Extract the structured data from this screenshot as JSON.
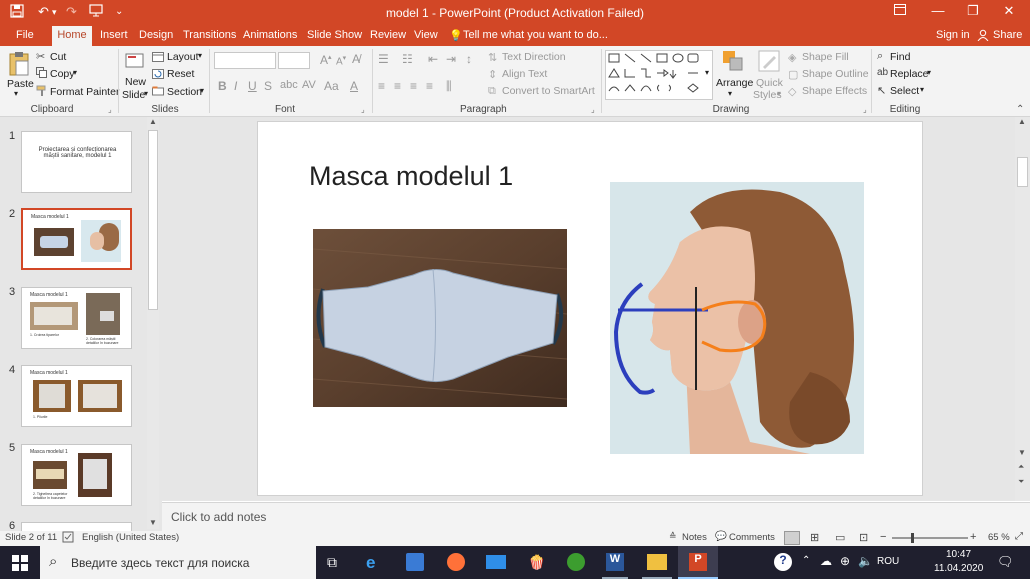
{
  "titlebar": {
    "title": "model 1 - PowerPoint (Product Activation Failed)",
    "save_icon": "save-icon",
    "undo_icon": "undo-icon",
    "redo_icon": "redo-icon",
    "present_icon": "present-from-beginning-icon"
  },
  "tabs": [
    "File",
    "Home",
    "Insert",
    "Design",
    "Transitions",
    "Animations",
    "Slide Show",
    "Review",
    "View"
  ],
  "tell_me": "Tell me what you want to do...",
  "sign_in": "Sign in",
  "share": "Share",
  "ribbon": {
    "clipboard": {
      "paste": "Paste",
      "cut": "Cut",
      "copy": "Copy",
      "format_painter": "Format Painter",
      "label": "Clipboard"
    },
    "slides": {
      "new_slide_1": "New",
      "new_slide_2": "Slide",
      "layout": "Layout",
      "reset": "Reset",
      "section": "Section",
      "label": "Slides"
    },
    "font": {
      "label": "Font"
    },
    "paragraph": {
      "text_direction": "Text Direction",
      "align_text": "Align Text",
      "convert_smartart": "Convert to SmartArt",
      "label": "Paragraph"
    },
    "drawing": {
      "arrange": "Arrange",
      "quick_styles_1": "Quick",
      "quick_styles_2": "Styles",
      "shape_fill": "Shape Fill",
      "shape_outline": "Shape Outline",
      "shape_effects": "Shape Effects",
      "label": "Drawing"
    },
    "editing": {
      "find": "Find",
      "replace": "Replace",
      "select": "Select",
      "label": "Editing"
    }
  },
  "thumbnails": [
    {
      "num": "1",
      "text": "Proiectarea și confecționarea măștii sanitare, modelul 1"
    },
    {
      "num": "2",
      "text": "Masca modelul 1"
    },
    {
      "num": "3",
      "text": "Masca modelul 1",
      "cap1": "1. Croirea tiparelor",
      "cap2": "2. Colorarea măștii detaliilor în buzunare"
    },
    {
      "num": "4",
      "text": "Masca modelul 1",
      "cap1": "1. Pliurile"
    },
    {
      "num": "5",
      "text": "Masca modelul 1",
      "cap1": "2. Tighelirea capetelor detaliilor în buzunare"
    },
    {
      "num": "6",
      "text": ""
    }
  ],
  "slide": {
    "title": "Masca modelul 1"
  },
  "notes_placeholder": "Click to add notes",
  "status": {
    "slide_info": "Slide 2 of 11",
    "language": "English (United States)",
    "notes": "Notes",
    "comments": "Comments",
    "zoom": "65 %"
  },
  "taskbar": {
    "search_placeholder": "Введите здесь текст для поиска",
    "lang": "ROU",
    "time": "10:47",
    "date": "11.04.2020"
  },
  "colors": {
    "accent": "#d24726",
    "taskbar": "#1f1f2e"
  }
}
